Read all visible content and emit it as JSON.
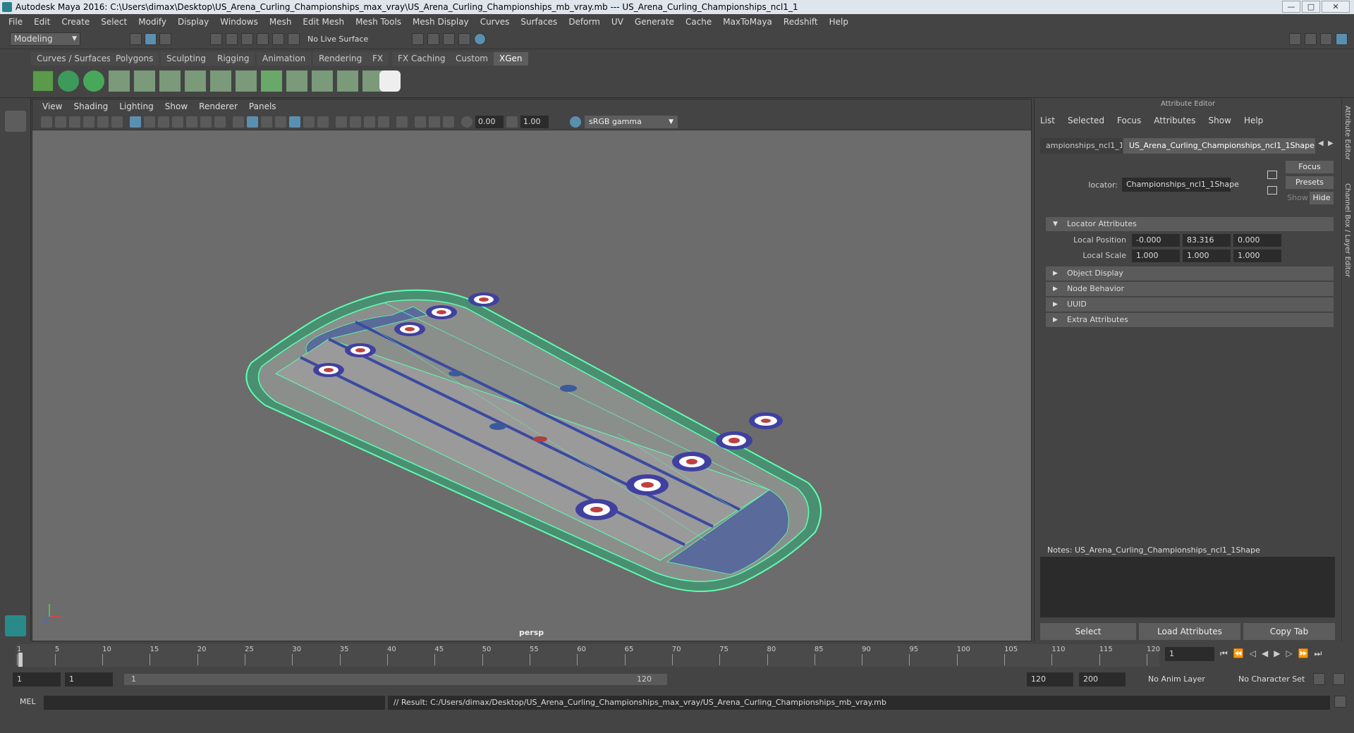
{
  "titlebar": {
    "title": "Autodesk Maya 2016: C:\\Users\\dimax\\Desktop\\US_Arena_Curling_Championships_max_vray\\US_Arena_Curling_Championships_mb_vray.mb  ---  US_Arena_Curling_Championships_ncl1_1",
    "minimize": "—",
    "maximize": "□",
    "close": "✕"
  },
  "menubar": [
    "File",
    "Edit",
    "Create",
    "Select",
    "Modify",
    "Display",
    "Windows",
    "Mesh",
    "Edit Mesh",
    "Mesh Tools",
    "Mesh Display",
    "Curves",
    "Surfaces",
    "Deform",
    "UV",
    "Generate",
    "Cache",
    "MaxToMaya",
    "Redshift",
    "Help"
  ],
  "status": {
    "mode": "Modeling",
    "live_surface": "No Live Surface"
  },
  "shelf_tabs": [
    "Curves / Surfaces",
    "Polygons",
    "Sculpting",
    "Rigging",
    "Animation",
    "Rendering",
    "FX",
    "FX Caching",
    "Custom",
    "XGen"
  ],
  "shelf_active": "XGen",
  "viewport": {
    "menu": [
      "View",
      "Shading",
      "Lighting",
      "Show",
      "Renderer",
      "Panels"
    ],
    "exposure": "0.00",
    "gamma_value": "1.00",
    "color_space": "sRGB gamma",
    "camera": "persp"
  },
  "attribute_editor": {
    "title": "Attribute Editor",
    "menu": [
      "List",
      "Selected",
      "Focus",
      "Attributes",
      "Show",
      "Help"
    ],
    "tab_a": "ampionships_ncl1_1",
    "tab_b": "US_Arena_Curling_Championships_ncl1_1Shape",
    "node_label": "locator:",
    "node_value": "Championships_ncl1_1Shape",
    "focus": "Focus",
    "presets": "Presets",
    "show": "Show",
    "hide": "Hide",
    "sections": {
      "locator": "Locator Attributes",
      "object_display": "Object Display",
      "node_behavior": "Node Behavior",
      "uuid": "UUID",
      "extra": "Extra Attributes"
    },
    "local_position_label": "Local Position",
    "local_position": [
      "-0.000",
      "83.316",
      "0.000"
    ],
    "local_scale_label": "Local Scale",
    "local_scale": [
      "1.000",
      "1.000",
      "1.000"
    ],
    "notes": "Notes:  US_Arena_Curling_Championships_ncl1_1Shape",
    "buttons": [
      "Select",
      "Load Attributes",
      "Copy Tab"
    ]
  },
  "side_tabs": [
    "Attribute Editor",
    "Channel Box / Layer Editor"
  ],
  "timeline": {
    "ticks": [
      "1",
      "5",
      "10",
      "15",
      "20",
      "25",
      "30",
      "35",
      "40",
      "45",
      "50",
      "55",
      "60",
      "65",
      "70",
      "75",
      "80",
      "85",
      "90",
      "95",
      "100",
      "105",
      "110",
      "115",
      "120"
    ],
    "current_frame": "1"
  },
  "range": {
    "start": "1",
    "start2": "1",
    "slider_start": "1",
    "slider_end": "120",
    "end": "120",
    "end2": "200",
    "anim_layer": "No Anim Layer",
    "character_set": "No Character Set"
  },
  "cmdline": {
    "lang": "MEL",
    "result": "// Result: C:/Users/dimax/Desktop/US_Arena_Curling_Championships_max_vray/US_Arena_Curling_Championships_mb_vray.mb"
  }
}
